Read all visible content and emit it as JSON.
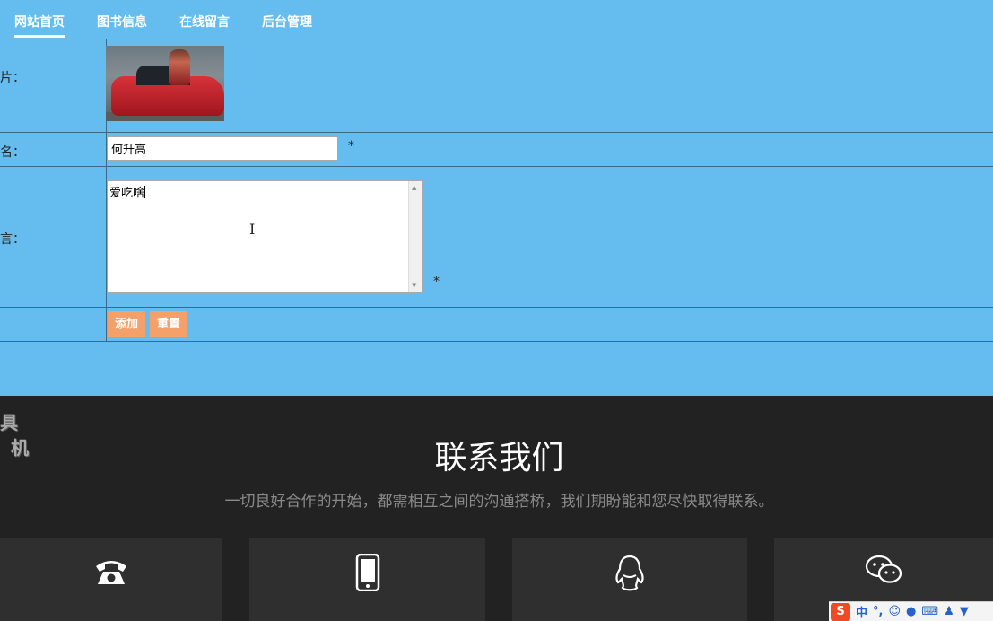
{
  "nav": [
    {
      "label": "网站首页",
      "active": true
    },
    {
      "label": "图书信息",
      "active": false
    },
    {
      "label": "在线留言",
      "active": false
    },
    {
      "label": "后台管理",
      "active": false
    }
  ],
  "form": {
    "photo_label": "照片：",
    "name_label": "姓名：",
    "name_value": "何升高",
    "message_label": "留言：",
    "message_value": "爱吃啥",
    "required_mark": "*",
    "add_button": "添加",
    "reset_button": "重置"
  },
  "footer": {
    "logo_fragment_line1": "具",
    "logo_fragment_line2": "机",
    "title": "联系我们",
    "subtitle": "一切良好合作的开始，都需相互之间的沟通搭桥，我们期盼能和您尽快取得联系。",
    "cards": [
      {
        "icon": "telephone-icon"
      },
      {
        "icon": "mobile-phone-icon"
      },
      {
        "icon": "qq-icon"
      },
      {
        "icon": "wechat-icon"
      }
    ]
  },
  "ime_toolbar": {
    "logo": "S",
    "mode": "中",
    "punct": "°,"
  },
  "colors": {
    "page_bg": "#64bdee",
    "footer_bg": "#222222",
    "card_bg": "#2f2f2f",
    "button_bg": "#f3a06a"
  }
}
